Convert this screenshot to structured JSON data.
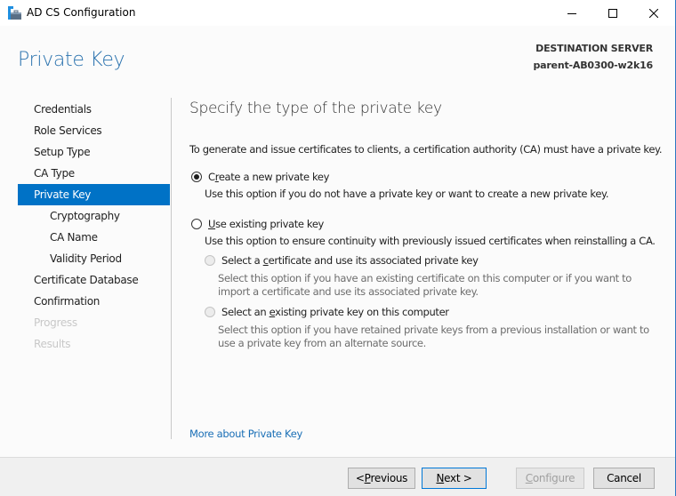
{
  "window": {
    "title": "AD CS Configuration",
    "icon": "server-manager-briefcase-icon",
    "controls": [
      "minimize",
      "maximize",
      "close"
    ]
  },
  "header": {
    "page_title": "Private Key",
    "destination_label": "DESTINATION SERVER",
    "destination_server": "parent-AB0300-w2k16"
  },
  "nav": {
    "items": [
      {
        "label": "Credentials",
        "state": "normal",
        "level": 0
      },
      {
        "label": "Role Services",
        "state": "normal",
        "level": 0
      },
      {
        "label": "Setup Type",
        "state": "normal",
        "level": 0
      },
      {
        "label": "CA Type",
        "state": "normal",
        "level": 0
      },
      {
        "label": "Private Key",
        "state": "active",
        "level": 0
      },
      {
        "label": "Cryptography",
        "state": "normal",
        "level": 1
      },
      {
        "label": "CA Name",
        "state": "normal",
        "level": 1
      },
      {
        "label": "Validity Period",
        "state": "normal",
        "level": 1
      },
      {
        "label": "Certificate Database",
        "state": "normal",
        "level": 0
      },
      {
        "label": "Confirmation",
        "state": "normal",
        "level": 0
      },
      {
        "label": "Progress",
        "state": "disabled",
        "level": 0
      },
      {
        "label": "Results",
        "state": "disabled",
        "level": 0
      }
    ]
  },
  "content": {
    "title": "Specify the type of the private key",
    "intro": "To generate and issue certificates to clients, a certification authority (CA) must have a private key.",
    "options": {
      "create_new": {
        "label_pre": "C",
        "label_accel": "r",
        "label_post": "eate a new private key",
        "checked": true,
        "description": "Use this option if you do not have a private key or want to create a new private key."
      },
      "use_existing": {
        "label_pre": "",
        "label_accel": "U",
        "label_post": "se existing private key",
        "checked": false,
        "description": "Use this option to ensure continuity with previously issued certificates when reinstalling a CA.",
        "sub_options": {
          "select_certificate": {
            "label_pre": "Select a ",
            "label_accel": "c",
            "label_post": "ertificate and use its associated private key",
            "enabled": false,
            "description_line1": "Select this option if you have an existing certificate on this computer or if you want to",
            "description_line2": "import a certificate and use its associated private key."
          },
          "select_existing_key": {
            "label_pre": "Select an ",
            "label_accel": "e",
            "label_post": "xisting private key on this computer",
            "enabled": false,
            "description_line1": "Select this option if you have retained private keys from a previous installation or want to",
            "description_line2": "use a private key from an alternate source."
          }
        }
      }
    },
    "more_link": "More about Private Key"
  },
  "footer": {
    "previous": {
      "pre": "< ",
      "accel": "P",
      "post": "revious"
    },
    "next": {
      "pre": "",
      "accel": "N",
      "post": "ext >"
    },
    "configure": {
      "pre": "",
      "accel": "C",
      "post": "onfigure",
      "enabled": false
    },
    "cancel": {
      "label": "Cancel"
    }
  },
  "colors": {
    "accent": "#0072c6",
    "header_title": "#2a72ae",
    "link": "#1a6fb6",
    "disabled_text": "#c8c8c8"
  }
}
